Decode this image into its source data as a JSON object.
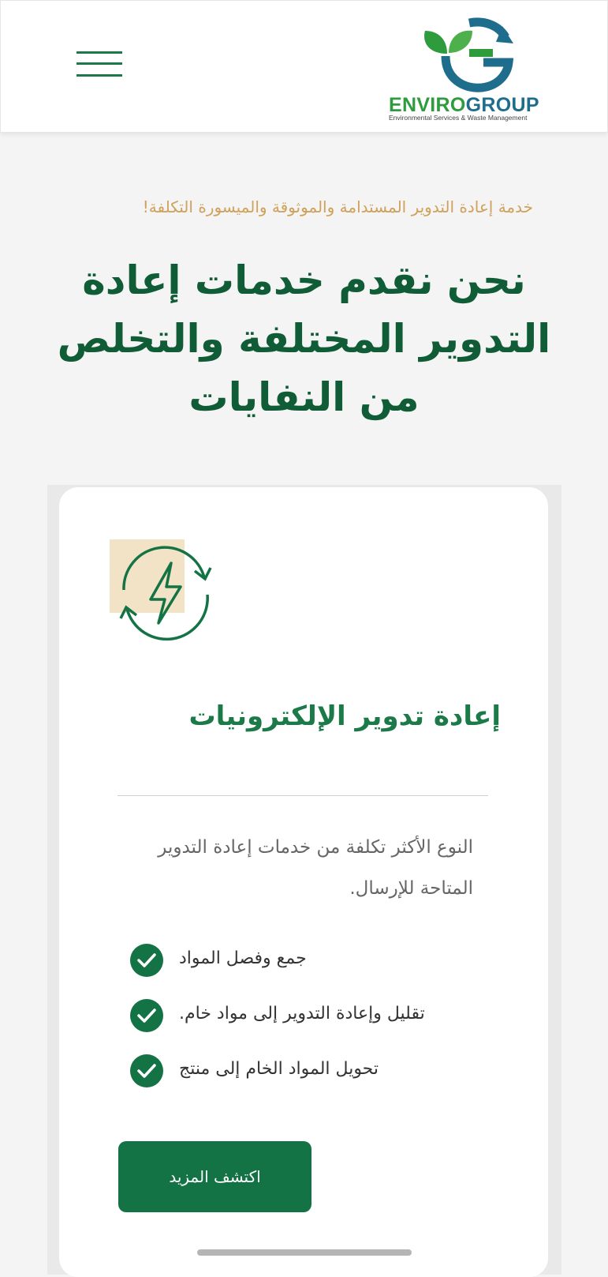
{
  "header": {
    "logo": {
      "brand_part1": "ENVIRO",
      "brand_part2": "GROUP",
      "subtitle": "Environmental Services & Waste Management",
      "colors": {
        "green": "#2e9b3d",
        "blue": "#1e6d8c"
      }
    },
    "menu_icon": "hamburger-menu-icon"
  },
  "hero": {
    "tagline": "خدمة إعادة التدوير المستدامة والموثوقة والميسورة التكلفة!",
    "headline": "نحن نقدم خدمات إعادة التدوير المختلفة والتخلص من النفايات"
  },
  "card": {
    "icon": "electronics-recycling-icon",
    "title": "إعادة تدوير الإلكترونيات",
    "description": "النوع الأكثر تكلفة من خدمات إعادة التدوير المتاحة للإرسال.",
    "features": [
      "جمع وفصل المواد",
      "تقليل وإعادة التدوير إلى مواد خام.",
      "تحويل المواد الخام إلى منتج"
    ],
    "cta_label": "اكتشف المزيد"
  },
  "colors": {
    "primary_green": "#137345",
    "headline_green": "#0f5c36",
    "tagline_gold": "#cfa15a",
    "icon_highlight": "#f3e3c6"
  }
}
